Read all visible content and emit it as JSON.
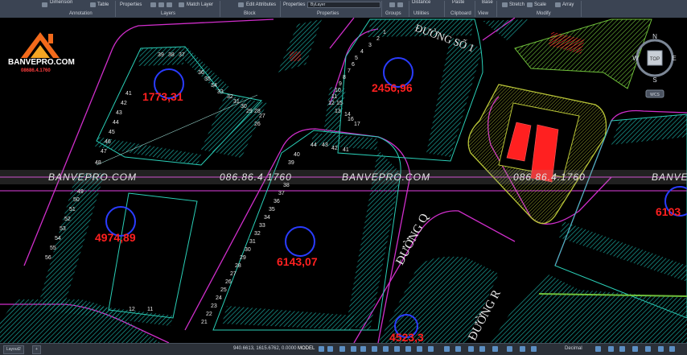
{
  "ribbon": {
    "buttons": [
      "Dimension",
      "Table",
      "Properties",
      "Match Layer",
      "Edit Attributes",
      "Properties",
      "ByLayer",
      "Distance",
      "Paste",
      "Base",
      "Stretch",
      "Scale",
      "Array"
    ],
    "groups": [
      "Annotation",
      "Layers",
      "Block",
      "Properties",
      "Groups",
      "Utilities",
      "Clipboard",
      "View",
      "Modify"
    ]
  },
  "logo": {
    "name": "BANVEPRO.COM",
    "phone": "08686.4.1760"
  },
  "watermark": {
    "site": "BANVEPRO.COM",
    "phone": "086.86.4.1760"
  },
  "map": {
    "blocks": [
      {
        "area": "1773,31"
      },
      {
        "area": "2456,96"
      },
      {
        "area": "4974,89"
      },
      {
        "area": "6143,07"
      },
      {
        "area": "6103"
      },
      {
        "area": "4523,3"
      }
    ],
    "roads": [
      {
        "label": "ĐƯỜNG SỐ 1"
      },
      {
        "label": "ĐƯỜNG Q"
      },
      {
        "label": "ĐƯỜNG R"
      }
    ],
    "lot_numbers_left": [
      "39",
      "38",
      "37",
      "36",
      "35",
      "34",
      "33",
      "32",
      "31",
      "30",
      "29",
      "28",
      "27",
      "26",
      "41",
      "42",
      "43",
      "44",
      "45",
      "46",
      "47",
      "48",
      "49",
      "50",
      "51",
      "52",
      "53",
      "54",
      "55",
      "56",
      "12",
      "11"
    ],
    "lot_numbers_top": [
      "1",
      "2",
      "3",
      "4",
      "5",
      "6",
      "7",
      "8",
      "9",
      "10",
      "11",
      "12",
      "13",
      "14",
      "15",
      "16",
      "17"
    ],
    "lot_numbers_mid": [
      "44",
      "43",
      "42",
      "41",
      "40",
      "39",
      "38",
      "37",
      "36",
      "35",
      "34",
      "33",
      "32",
      "31",
      "30",
      "29",
      "28",
      "27",
      "26",
      "25",
      "24",
      "23",
      "22",
      "21"
    ]
  },
  "navcube": {
    "n": "N",
    "s": "S",
    "w": "W",
    "e": "E",
    "top": "TOP",
    "wcs": "WCS"
  },
  "statusbar": {
    "coords": "940.6613, 1615.6762, 0.0000",
    "space": "MODEL",
    "units": "Decimal",
    "tabs": [
      "Layout2"
    ],
    "add_tab": "+"
  },
  "colors": {
    "canvas": "#000000",
    "lot_fill": "#1aa39a",
    "road_edge": "#d02ecb",
    "area_text": "#ff2020",
    "block_ring": "#2a3cff"
  }
}
